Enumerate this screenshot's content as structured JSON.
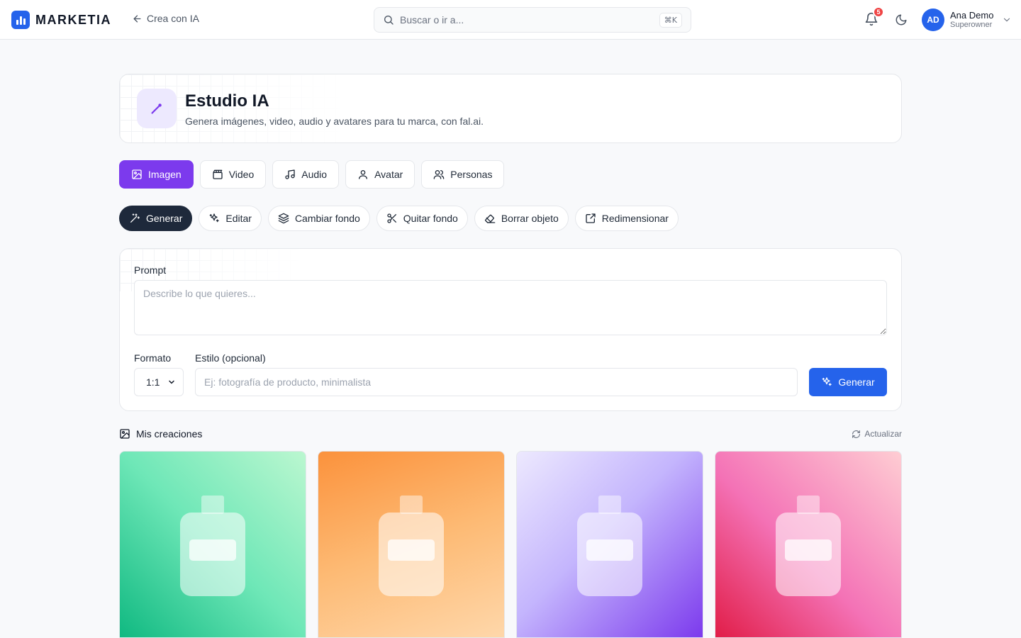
{
  "app": {
    "brand": "MARKETIA",
    "back_label": "Crea con IA"
  },
  "search": {
    "placeholder": "Buscar o ir a...",
    "shortcut": "⌘K"
  },
  "notifications": {
    "count": "5"
  },
  "user": {
    "initials": "AD",
    "name": "Ana Demo",
    "role": "Superowner"
  },
  "header": {
    "title": "Estudio IA",
    "subtitle": "Genera imágenes, video, audio y avatares para tu marca, con fal.ai."
  },
  "media_tabs": [
    {
      "label": "Imagen",
      "icon": "image-icon",
      "active": true
    },
    {
      "label": "Video",
      "icon": "clapperboard-icon",
      "active": false
    },
    {
      "label": "Audio",
      "icon": "music-icon",
      "active": false
    },
    {
      "label": "Avatar",
      "icon": "user-icon",
      "active": false
    },
    {
      "label": "Personas",
      "icon": "users-icon",
      "active": false
    }
  ],
  "tools": [
    {
      "label": "Generar",
      "icon": "wand-icon",
      "active": true
    },
    {
      "label": "Editar",
      "icon": "sparkles-icon",
      "active": false
    },
    {
      "label": "Cambiar fondo",
      "icon": "layers-icon",
      "active": false
    },
    {
      "label": "Quitar fondo",
      "icon": "scissors-icon",
      "active": false
    },
    {
      "label": "Borrar objeto",
      "icon": "eraser-icon",
      "active": false
    },
    {
      "label": "Redimensionar",
      "icon": "resize-icon",
      "active": false
    }
  ],
  "form": {
    "prompt_label": "Prompt",
    "prompt_placeholder": "Describe lo que quieres...",
    "prompt_value": "",
    "format_label": "Formato",
    "format_value": "1:1",
    "style_label": "Estilo (opcional)",
    "style_placeholder": "Ej: fotografía de producto, minimalista",
    "style_value": "",
    "generate_label": "Generar"
  },
  "creations": {
    "title": "Mis creaciones",
    "refresh_label": "Actualizar",
    "items": [
      {
        "name": "creation-green",
        "gradient_from": "#10b981",
        "gradient_to": "#bbf7d0"
      },
      {
        "name": "creation-orange",
        "gradient_from": "#fb923c",
        "gradient_to": "#fed7aa"
      },
      {
        "name": "creation-purple",
        "gradient_from": "#ddd6fe",
        "gradient_to": "#7c3aed"
      },
      {
        "name": "creation-red",
        "gradient_from": "#e11d48",
        "gradient_to": "#fecdd3"
      }
    ]
  },
  "colors": {
    "accent_purple": "#7c3aed",
    "primary_blue": "#2563eb",
    "dark_chip": "#1e293b",
    "badge_red": "#ef4444"
  }
}
